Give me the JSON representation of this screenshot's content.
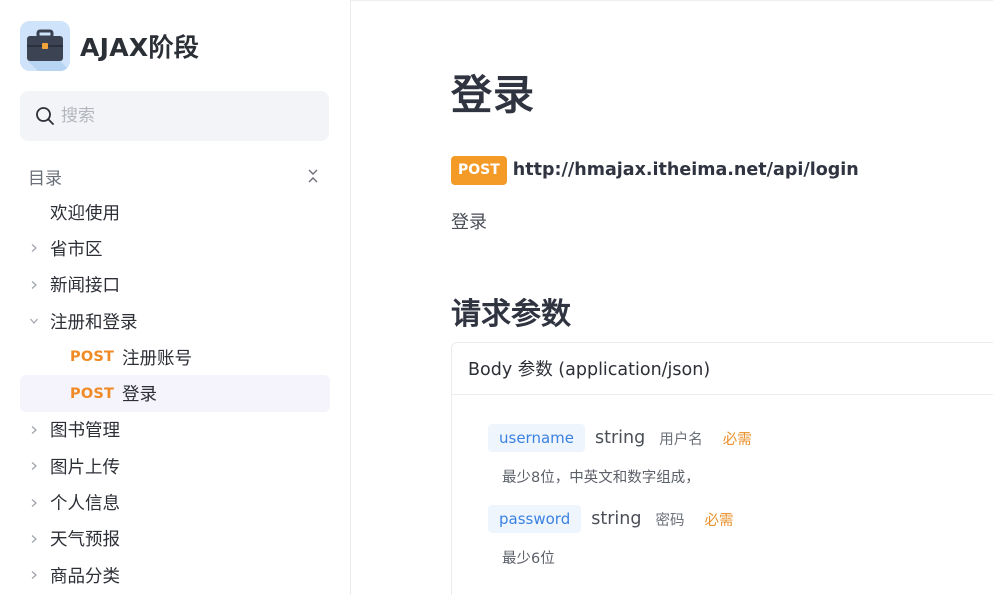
{
  "app": {
    "title": "AJAX阶段",
    "logo_icon": "briefcase-icon"
  },
  "search": {
    "placeholder": "搜索",
    "icon": "search-icon"
  },
  "toc": {
    "title": "目录",
    "collapse_icon": "collapse-icon"
  },
  "nav": {
    "items": [
      {
        "label": "欢迎使用"
      },
      {
        "label": "省市区"
      },
      {
        "label": "新闻接口"
      },
      {
        "label": "注册和登录"
      },
      {
        "method": "POST",
        "label": "注册账号"
      },
      {
        "method": "POST",
        "label": "登录"
      },
      {
        "label": "图书管理"
      },
      {
        "label": "图片上传"
      },
      {
        "label": "个人信息"
      },
      {
        "label": "天气预报"
      },
      {
        "label": "商品分类"
      }
    ]
  },
  "main": {
    "title": "登录",
    "method": "POST",
    "url": "http://hmajax.itheima.net/api/login",
    "description": "登录",
    "section_title": "请求参数",
    "body_header": "Body 参数 (application/json)",
    "params": [
      {
        "name": "username",
        "type": "string",
        "label": "用户名",
        "required": "必需",
        "description": "最少8位，中英文和数字组成，"
      },
      {
        "name": "password",
        "type": "string",
        "label": "密码",
        "required": "必需",
        "description": "最少6位"
      }
    ]
  },
  "colors": {
    "accent_orange": "#f39a27",
    "param_blue": "#3b82e0",
    "active_bg": "#f5f3fb"
  }
}
